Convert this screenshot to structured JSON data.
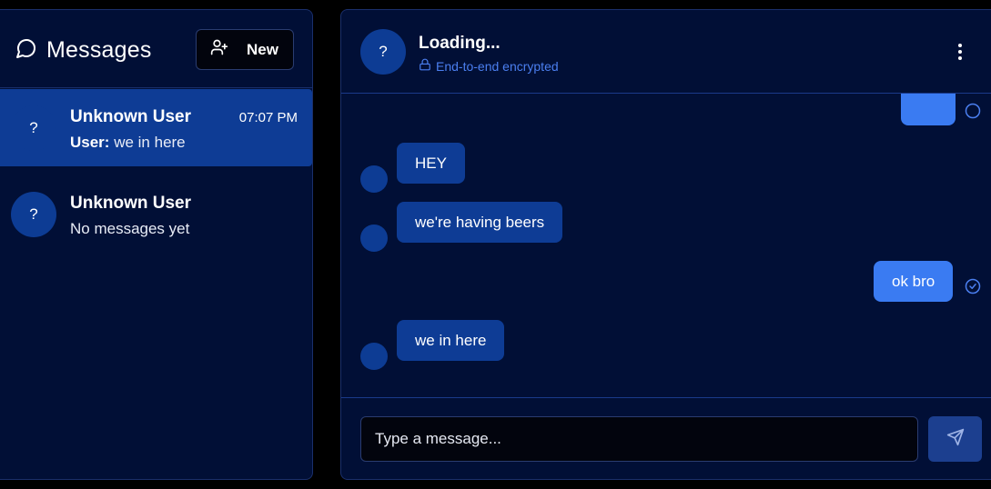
{
  "sidebar": {
    "title": "Messages",
    "new_button_label": "New",
    "conversations": [
      {
        "avatar_text": "?",
        "name": "Unknown User",
        "time": "07:07 PM",
        "preview_sender": "User:",
        "preview_text": "we in here"
      },
      {
        "avatar_text": "?",
        "name": "Unknown User",
        "preview_text": "No messages yet"
      }
    ]
  },
  "chat": {
    "avatar_text": "?",
    "title": "Loading...",
    "encryption_label": "End-to-end encrypted",
    "messages": [
      {
        "direction": "outgoing",
        "text": ""
      },
      {
        "direction": "incoming",
        "text": "HEY"
      },
      {
        "direction": "incoming",
        "text": "we're having beers"
      },
      {
        "direction": "outgoing",
        "text": "ok bro"
      },
      {
        "direction": "incoming",
        "text": "we in here"
      }
    ],
    "input_placeholder": "Type a message..."
  },
  "colors": {
    "background": "#000000",
    "panel": "#010f36",
    "active_item": "#0e3c95",
    "incoming_bubble": "#0e3c95",
    "outgoing_bubble": "#3a7bf2",
    "accent_text": "#4b7ff0",
    "send_button": "#1c3f8f"
  },
  "icons": {
    "messages": "chat-bubble-icon",
    "new": "user-plus-icon",
    "lock": "lock-icon",
    "menu": "more-vertical-icon",
    "read": "check-circle-icon",
    "send": "send-icon"
  }
}
